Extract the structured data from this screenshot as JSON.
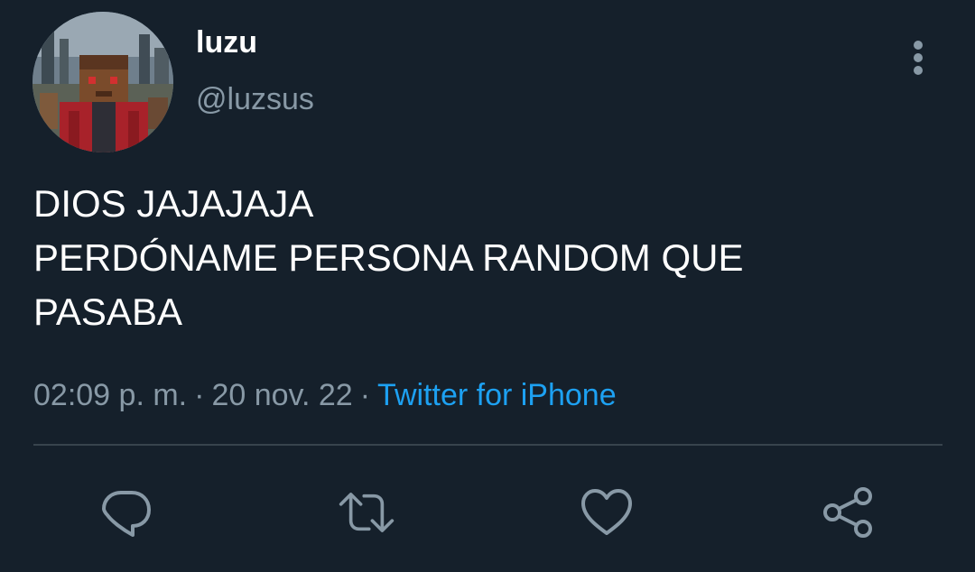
{
  "author": {
    "display_name": "luzu",
    "handle": "@luzsus"
  },
  "tweet": {
    "lines": [
      "DIOS JAJAJAJA",
      "PERDÓNAME PERSONA RANDOM QUE",
      "PASABA"
    ],
    "time": "02:09 p. m.",
    "date": "20 nov. 22",
    "separator": "·",
    "source": "Twitter for iPhone"
  },
  "actions": {
    "icons": [
      "reply-icon",
      "retweet-icon",
      "like-icon",
      "share-icon"
    ]
  },
  "colors": {
    "background": "#15202b",
    "text": "#ffffff",
    "secondary": "#8899a6",
    "accent": "#1da1f2",
    "divider": "#38444d"
  }
}
